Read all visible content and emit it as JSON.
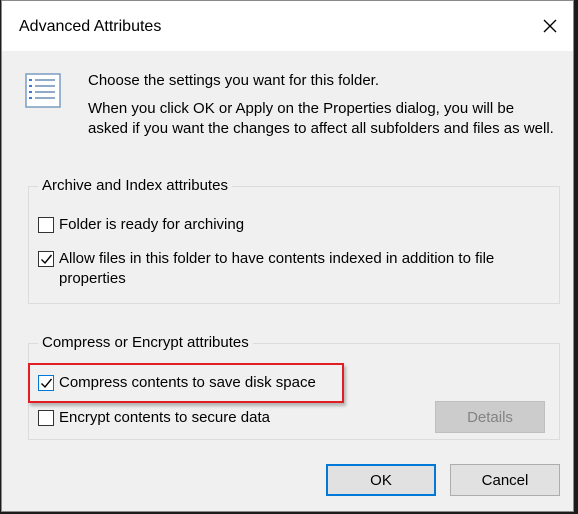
{
  "window": {
    "title": "Advanced Attributes",
    "close_icon": "close-icon"
  },
  "info": {
    "icon": "attributes-list-icon",
    "line1": "Choose the settings you want for this folder.",
    "line2": "When you click OK or Apply on the Properties dialog, you will be asked if you want the changes to affect all subfolders and files as well."
  },
  "archive_group": {
    "legend": "Archive and Index attributes",
    "ready_for_archiving": {
      "label": "Folder is ready for archiving",
      "checked": false
    },
    "allow_indexing": {
      "label": "Allow files in this folder to have contents indexed in addition to file properties",
      "checked": true
    }
  },
  "compress_group": {
    "legend": "Compress or Encrypt attributes",
    "compress": {
      "label": "Compress contents to save disk space",
      "checked": true
    },
    "encrypt": {
      "label": "Encrypt contents to secure data",
      "checked": false
    },
    "details_label": "Details"
  },
  "buttons": {
    "ok": "OK",
    "cancel": "Cancel"
  },
  "colors": {
    "highlight": "#e01e24",
    "accent": "#0078d7"
  }
}
